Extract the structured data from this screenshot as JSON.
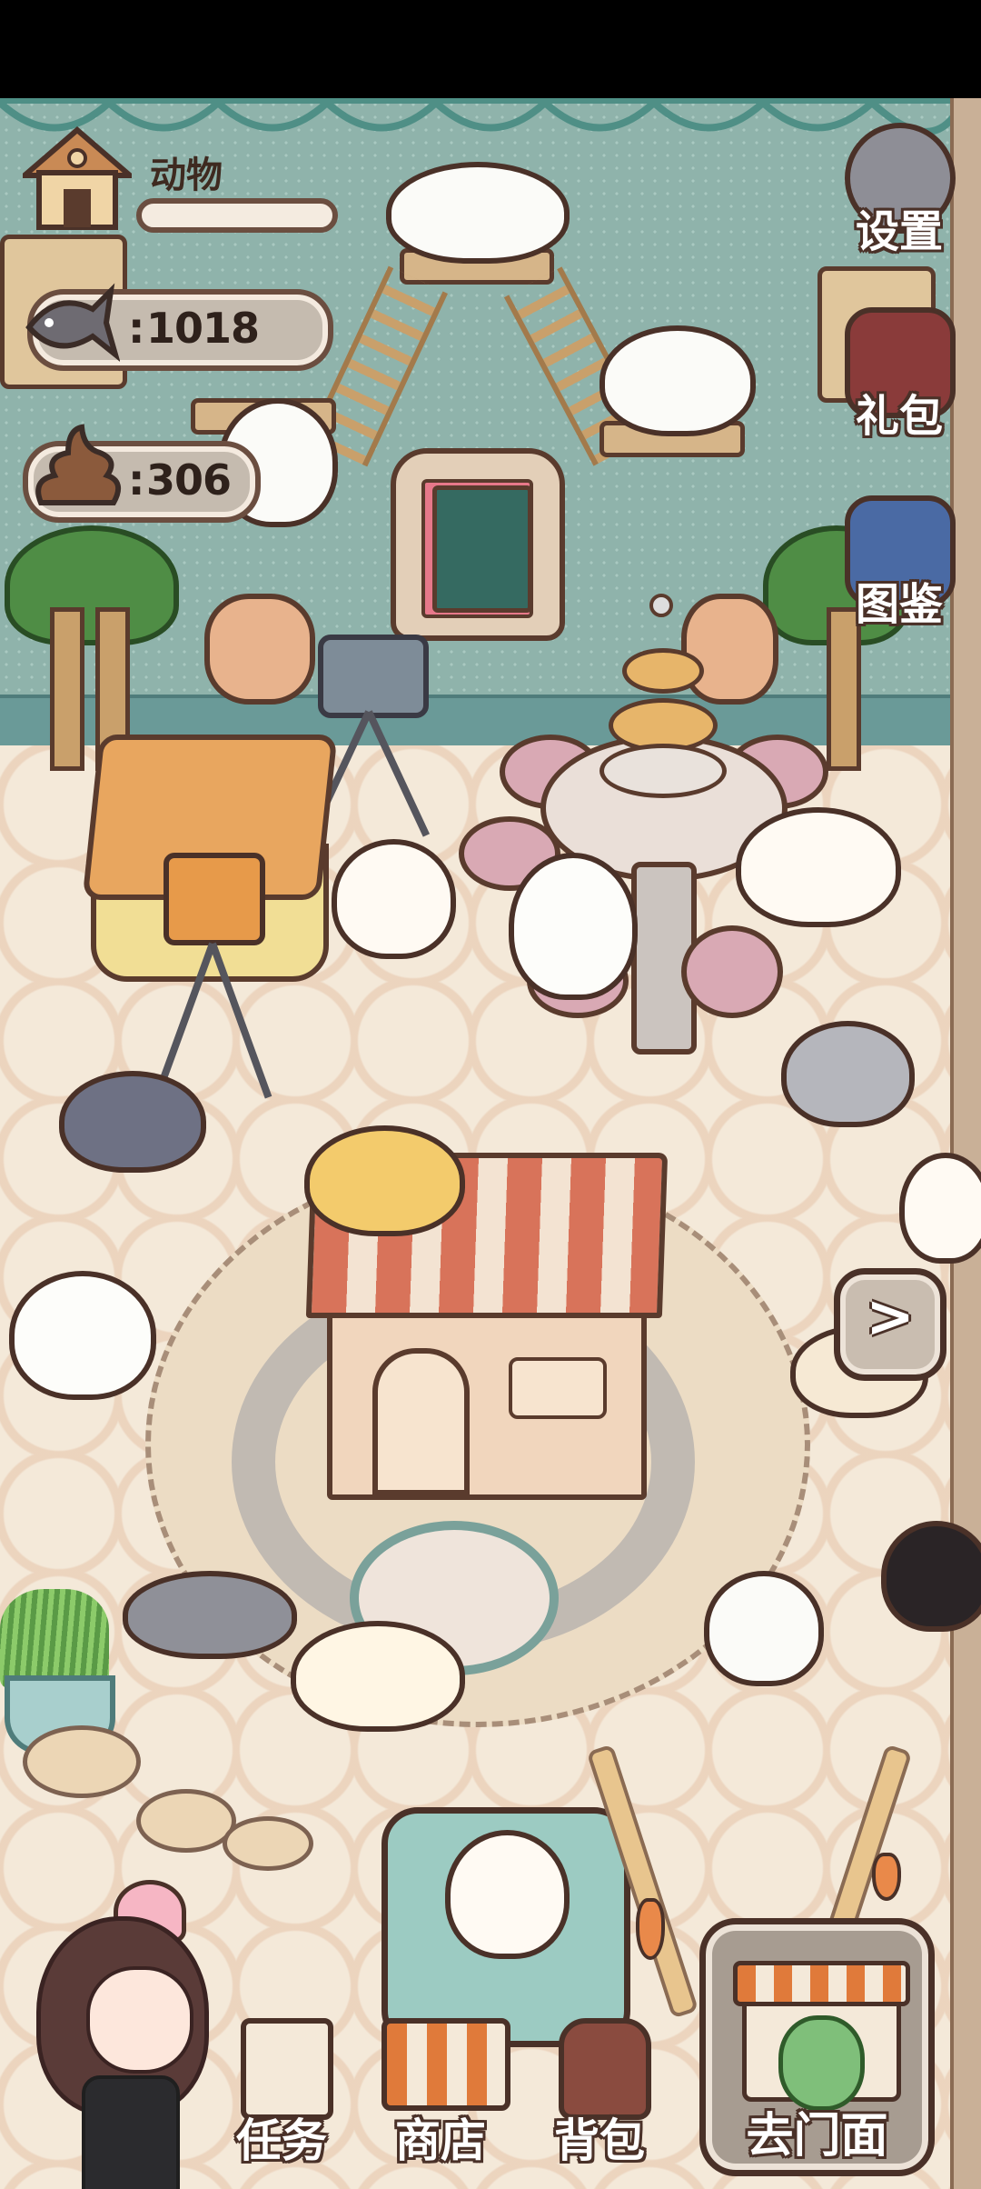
{
  "hud": {
    "title": "动物",
    "progress": 0,
    "fish_count": "1018",
    "poop_count": "306",
    "separator": ":"
  },
  "side_buttons": {
    "settings": "设置",
    "gift": "礼包",
    "catalog": "图鉴"
  },
  "next_arrow": ">",
  "bottom_nav": {
    "tasks": "任务",
    "shop": "商店",
    "backpack": "背包",
    "go_store": "去门面"
  },
  "icons": {
    "house": "house-icon",
    "fish": "fish-icon",
    "poop": "poop-icon",
    "gear": "gear-icon",
    "gift": "gift-icon",
    "book": "book-icon",
    "task": "task-icon",
    "shop": "shop-awning-icon",
    "backpack": "backpack-icon",
    "storefront": "storefront-icon"
  },
  "colors": {
    "wall": "#8fb3ab",
    "floor": "#f4e9d9",
    "outline": "#4a3128",
    "pill": "#c5bbaf"
  }
}
